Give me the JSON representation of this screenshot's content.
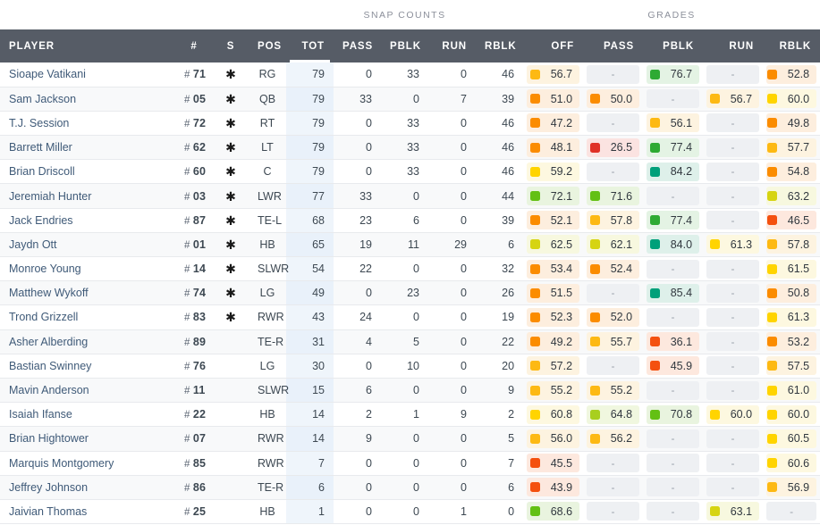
{
  "groups": [
    {
      "label": "",
      "span": 4,
      "blank": true
    },
    {
      "label": "SNAP COUNTS",
      "span": 5,
      "blank": false
    },
    {
      "label": "GRADES",
      "span": 5,
      "blank": false
    }
  ],
  "columns": {
    "player": "PLAYER",
    "number": "#",
    "s": "S",
    "pos": "POS",
    "snap_tot": "TOT",
    "snap_pass": "PASS",
    "snap_pblk": "PBLK",
    "snap_run": "RUN",
    "snap_rblk": "RBLK",
    "grade_off": "OFF",
    "grade_pass": "PASS",
    "grade_pblk": "PBLK",
    "grade_run": "RUN",
    "grade_rblk": "RBLK"
  },
  "sorted_column": "TOT",
  "colors": {
    "header_bg": "#565c66",
    "header_sorted_bg": "#3c4148",
    "group_bg": "#e4e7ec",
    "tot_column_bg": "#eff5fb",
    "player_link": "#3f5a78",
    "empty_cell_bg": "#eef0f3",
    "grade_red": "#e03127",
    "grade_orange_deep": "#f4500f",
    "grade_orange": "#fb8c00",
    "grade_amber": "#fdb913",
    "grade_yellow": "#ffd400",
    "grade_yellow_green": "#d6d412",
    "grade_lime": "#a8cf1f",
    "grade_green": "#63c014",
    "grade_green_deep": "#2eaa33",
    "grade_teal": "#00a07a"
  },
  "star_glyph": "✱",
  "dash": "-",
  "rows": [
    {
      "player": "Sioape Vatikani",
      "num": "71",
      "star": true,
      "pos": "RG",
      "snaps": [
        79,
        0,
        33,
        0,
        46
      ],
      "grades": [
        {
          "v": "56.7",
          "c": "#fdb913",
          "bg": "#fdf3e0"
        },
        null,
        {
          "v": "76.7",
          "c": "#2eaa33",
          "bg": "#e4f3e4"
        },
        null,
        {
          "v": "52.8",
          "c": "#fb8c00",
          "bg": "#fdeede"
        }
      ]
    },
    {
      "player": "Sam Jackson",
      "num": "05",
      "star": true,
      "pos": "QB",
      "snaps": [
        79,
        33,
        0,
        7,
        39
      ],
      "grades": [
        {
          "v": "51.0",
          "c": "#fb8c00",
          "bg": "#fdeede"
        },
        {
          "v": "50.0",
          "c": "#fb8c00",
          "bg": "#fdeede"
        },
        null,
        {
          "v": "56.7",
          "c": "#fdb913",
          "bg": "#fdf3e0"
        },
        {
          "v": "60.0",
          "c": "#ffd400",
          "bg": "#fdf8e0"
        }
      ]
    },
    {
      "player": "T.J. Session",
      "num": "72",
      "star": true,
      "pos": "RT",
      "snaps": [
        79,
        0,
        33,
        0,
        46
      ],
      "grades": [
        {
          "v": "47.2",
          "c": "#fb8c00",
          "bg": "#fdeede"
        },
        null,
        {
          "v": "56.1",
          "c": "#fdb913",
          "bg": "#fdf3e0"
        },
        null,
        {
          "v": "49.8",
          "c": "#fb8c00",
          "bg": "#fdeede"
        }
      ]
    },
    {
      "player": "Barrett Miller",
      "num": "62",
      "star": true,
      "pos": "LT",
      "snaps": [
        79,
        0,
        33,
        0,
        46
      ],
      "grades": [
        {
          "v": "48.1",
          "c": "#fb8c00",
          "bg": "#fdeede"
        },
        {
          "v": "26.5",
          "c": "#e03127",
          "bg": "#fbe3e1"
        },
        {
          "v": "77.4",
          "c": "#2eaa33",
          "bg": "#e4f3e4"
        },
        null,
        {
          "v": "57.7",
          "c": "#fdb913",
          "bg": "#fdf3e0"
        }
      ]
    },
    {
      "player": "Brian Driscoll",
      "num": "60",
      "star": true,
      "pos": "C",
      "snaps": [
        79,
        0,
        33,
        0,
        46
      ],
      "grades": [
        {
          "v": "59.2",
          "c": "#ffd400",
          "bg": "#fdf8e0"
        },
        null,
        {
          "v": "84.2",
          "c": "#00a07a",
          "bg": "#def0ea"
        },
        null,
        {
          "v": "54.8",
          "c": "#fb8c00",
          "bg": "#fdeede"
        }
      ]
    },
    {
      "player": "Jeremiah Hunter",
      "num": "03",
      "star": true,
      "pos": "LWR",
      "snaps": [
        77,
        33,
        0,
        0,
        44
      ],
      "grades": [
        {
          "v": "72.1",
          "c": "#63c014",
          "bg": "#e9f4df"
        },
        {
          "v": "71.6",
          "c": "#63c014",
          "bg": "#e9f4df"
        },
        null,
        null,
        {
          "v": "63.2",
          "c": "#d6d412",
          "bg": "#f7f8df"
        }
      ]
    },
    {
      "player": "Jack Endries",
      "num": "87",
      "star": true,
      "pos": "TE-L",
      "snaps": [
        68,
        23,
        6,
        0,
        39
      ],
      "grades": [
        {
          "v": "52.1",
          "c": "#fb8c00",
          "bg": "#fdeede"
        },
        {
          "v": "57.8",
          "c": "#fdb913",
          "bg": "#fdf3e0"
        },
        {
          "v": "77.4",
          "c": "#2eaa33",
          "bg": "#e4f3e4"
        },
        null,
        {
          "v": "46.5",
          "c": "#f4500f",
          "bg": "#fde8de"
        }
      ]
    },
    {
      "player": "Jaydn Ott",
      "num": "01",
      "star": true,
      "pos": "HB",
      "snaps": [
        65,
        19,
        11,
        29,
        6
      ],
      "grades": [
        {
          "v": "62.5",
          "c": "#d6d412",
          "bg": "#f7f8df"
        },
        {
          "v": "62.1",
          "c": "#d6d412",
          "bg": "#f7f8df"
        },
        {
          "v": "84.0",
          "c": "#00a07a",
          "bg": "#def0ea"
        },
        {
          "v": "61.3",
          "c": "#ffd400",
          "bg": "#fdf8e0"
        },
        {
          "v": "57.8",
          "c": "#fdb913",
          "bg": "#fdf3e0"
        }
      ]
    },
    {
      "player": "Monroe Young",
      "num": "14",
      "star": true,
      "pos": "SLWR",
      "snaps": [
        54,
        22,
        0,
        0,
        32
      ],
      "grades": [
        {
          "v": "53.4",
          "c": "#fb8c00",
          "bg": "#fdeede"
        },
        {
          "v": "52.4",
          "c": "#fb8c00",
          "bg": "#fdeede"
        },
        null,
        null,
        {
          "v": "61.5",
          "c": "#ffd400",
          "bg": "#fdf8e0"
        }
      ]
    },
    {
      "player": "Matthew Wykoff",
      "num": "74",
      "star": true,
      "pos": "LG",
      "snaps": [
        49,
        0,
        23,
        0,
        26
      ],
      "grades": [
        {
          "v": "51.5",
          "c": "#fb8c00",
          "bg": "#fdeede"
        },
        null,
        {
          "v": "85.4",
          "c": "#00a07a",
          "bg": "#def0ea"
        },
        null,
        {
          "v": "50.8",
          "c": "#fb8c00",
          "bg": "#fdeede"
        }
      ]
    },
    {
      "player": "Trond Grizzell",
      "num": "83",
      "star": true,
      "pos": "RWR",
      "snaps": [
        43,
        24,
        0,
        0,
        19
      ],
      "grades": [
        {
          "v": "52.3",
          "c": "#fb8c00",
          "bg": "#fdeede"
        },
        {
          "v": "52.0",
          "c": "#fb8c00",
          "bg": "#fdeede"
        },
        null,
        null,
        {
          "v": "61.3",
          "c": "#ffd400",
          "bg": "#fdf8e0"
        }
      ]
    },
    {
      "player": "Asher Alberding",
      "num": "89",
      "star": false,
      "pos": "TE-R",
      "snaps": [
        31,
        4,
        5,
        0,
        22
      ],
      "grades": [
        {
          "v": "49.2",
          "c": "#fb8c00",
          "bg": "#fdeede"
        },
        {
          "v": "55.7",
          "c": "#fdb913",
          "bg": "#fdf3e0"
        },
        {
          "v": "36.1",
          "c": "#f4500f",
          "bg": "#fde8de"
        },
        null,
        {
          "v": "53.2",
          "c": "#fb8c00",
          "bg": "#fdeede"
        }
      ]
    },
    {
      "player": "Bastian Swinney",
      "num": "76",
      "star": false,
      "pos": "LG",
      "snaps": [
        30,
        0,
        10,
        0,
        20
      ],
      "grades": [
        {
          "v": "57.2",
          "c": "#fdb913",
          "bg": "#fdf3e0"
        },
        null,
        {
          "v": "45.9",
          "c": "#f4500f",
          "bg": "#fde8de"
        },
        null,
        {
          "v": "57.5",
          "c": "#fdb913",
          "bg": "#fdf3e0"
        }
      ]
    },
    {
      "player": "Mavin Anderson",
      "num": "11",
      "star": false,
      "pos": "SLWR",
      "snaps": [
        15,
        6,
        0,
        0,
        9
      ],
      "grades": [
        {
          "v": "55.2",
          "c": "#fdb913",
          "bg": "#fdf3e0"
        },
        {
          "v": "55.2",
          "c": "#fdb913",
          "bg": "#fdf3e0"
        },
        null,
        null,
        {
          "v": "61.0",
          "c": "#ffd400",
          "bg": "#fdf8e0"
        }
      ]
    },
    {
      "player": "Isaiah Ifanse",
      "num": "22",
      "star": false,
      "pos": "HB",
      "snaps": [
        14,
        2,
        1,
        9,
        2
      ],
      "grades": [
        {
          "v": "60.8",
          "c": "#ffd400",
          "bg": "#fdf8e0"
        },
        {
          "v": "64.8",
          "c": "#a8cf1f",
          "bg": "#f0f7df"
        },
        {
          "v": "70.8",
          "c": "#63c014",
          "bg": "#e9f4df"
        },
        {
          "v": "60.0",
          "c": "#ffd400",
          "bg": "#fdf8e0"
        },
        {
          "v": "60.0",
          "c": "#ffd400",
          "bg": "#fdf8e0"
        }
      ]
    },
    {
      "player": "Brian Hightower",
      "num": "07",
      "star": false,
      "pos": "RWR",
      "snaps": [
        14,
        9,
        0,
        0,
        5
      ],
      "grades": [
        {
          "v": "56.0",
          "c": "#fdb913",
          "bg": "#fdf3e0"
        },
        {
          "v": "56.2",
          "c": "#fdb913",
          "bg": "#fdf3e0"
        },
        null,
        null,
        {
          "v": "60.5",
          "c": "#ffd400",
          "bg": "#fdf8e0"
        }
      ]
    },
    {
      "player": "Marquis Montgomery",
      "num": "85",
      "star": false,
      "pos": "RWR",
      "snaps": [
        7,
        0,
        0,
        0,
        7
      ],
      "grades": [
        {
          "v": "45.5",
          "c": "#f4500f",
          "bg": "#fde8de"
        },
        null,
        null,
        null,
        {
          "v": "60.6",
          "c": "#ffd400",
          "bg": "#fdf8e0"
        }
      ]
    },
    {
      "player": "Jeffrey Johnson",
      "num": "86",
      "star": false,
      "pos": "TE-R",
      "snaps": [
        6,
        0,
        0,
        0,
        6
      ],
      "grades": [
        {
          "v": "43.9",
          "c": "#f4500f",
          "bg": "#fde8de"
        },
        null,
        null,
        null,
        {
          "v": "56.9",
          "c": "#fdb913",
          "bg": "#fdf3e0"
        }
      ]
    },
    {
      "player": "Jaivian Thomas",
      "num": "25",
      "star": false,
      "pos": "HB",
      "snaps": [
        1,
        0,
        0,
        1,
        0
      ],
      "grades": [
        {
          "v": "68.6",
          "c": "#63c014",
          "bg": "#e9f4df"
        },
        null,
        null,
        {
          "v": "63.1",
          "c": "#d6d412",
          "bg": "#f7f8df"
        },
        null
      ]
    }
  ]
}
